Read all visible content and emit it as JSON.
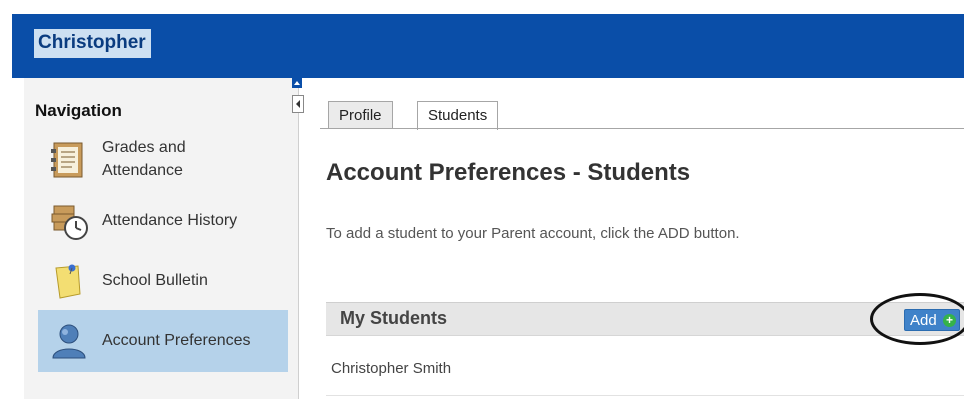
{
  "header": {
    "user_name": "Christopher"
  },
  "sidebar": {
    "title": "Navigation",
    "items": [
      {
        "label_line1": "Grades and",
        "label_line2": "Attendance",
        "icon": "gradebook-icon",
        "active": false
      },
      {
        "label": "Attendance History",
        "icon": "attendance-history-icon",
        "active": false
      },
      {
        "label": "School Bulletin",
        "icon": "bulletin-icon",
        "active": false
      },
      {
        "label": "Account Preferences",
        "icon": "account-user-icon",
        "active": true
      }
    ]
  },
  "tabs": [
    {
      "label": "Profile",
      "active": false
    },
    {
      "label": "Students",
      "active": true
    }
  ],
  "main": {
    "title": "Account Preferences - Students",
    "instruction": "To add a student to your Parent account, click the ADD button.",
    "students_panel": {
      "title": "My Students",
      "add_label": "Add",
      "students": [
        "Christopher Smith"
      ]
    }
  },
  "colors": {
    "header_bg": "#0a4ea8",
    "active_nav_bg": "#b5d2ea",
    "add_button_bg": "#3f82c9"
  }
}
